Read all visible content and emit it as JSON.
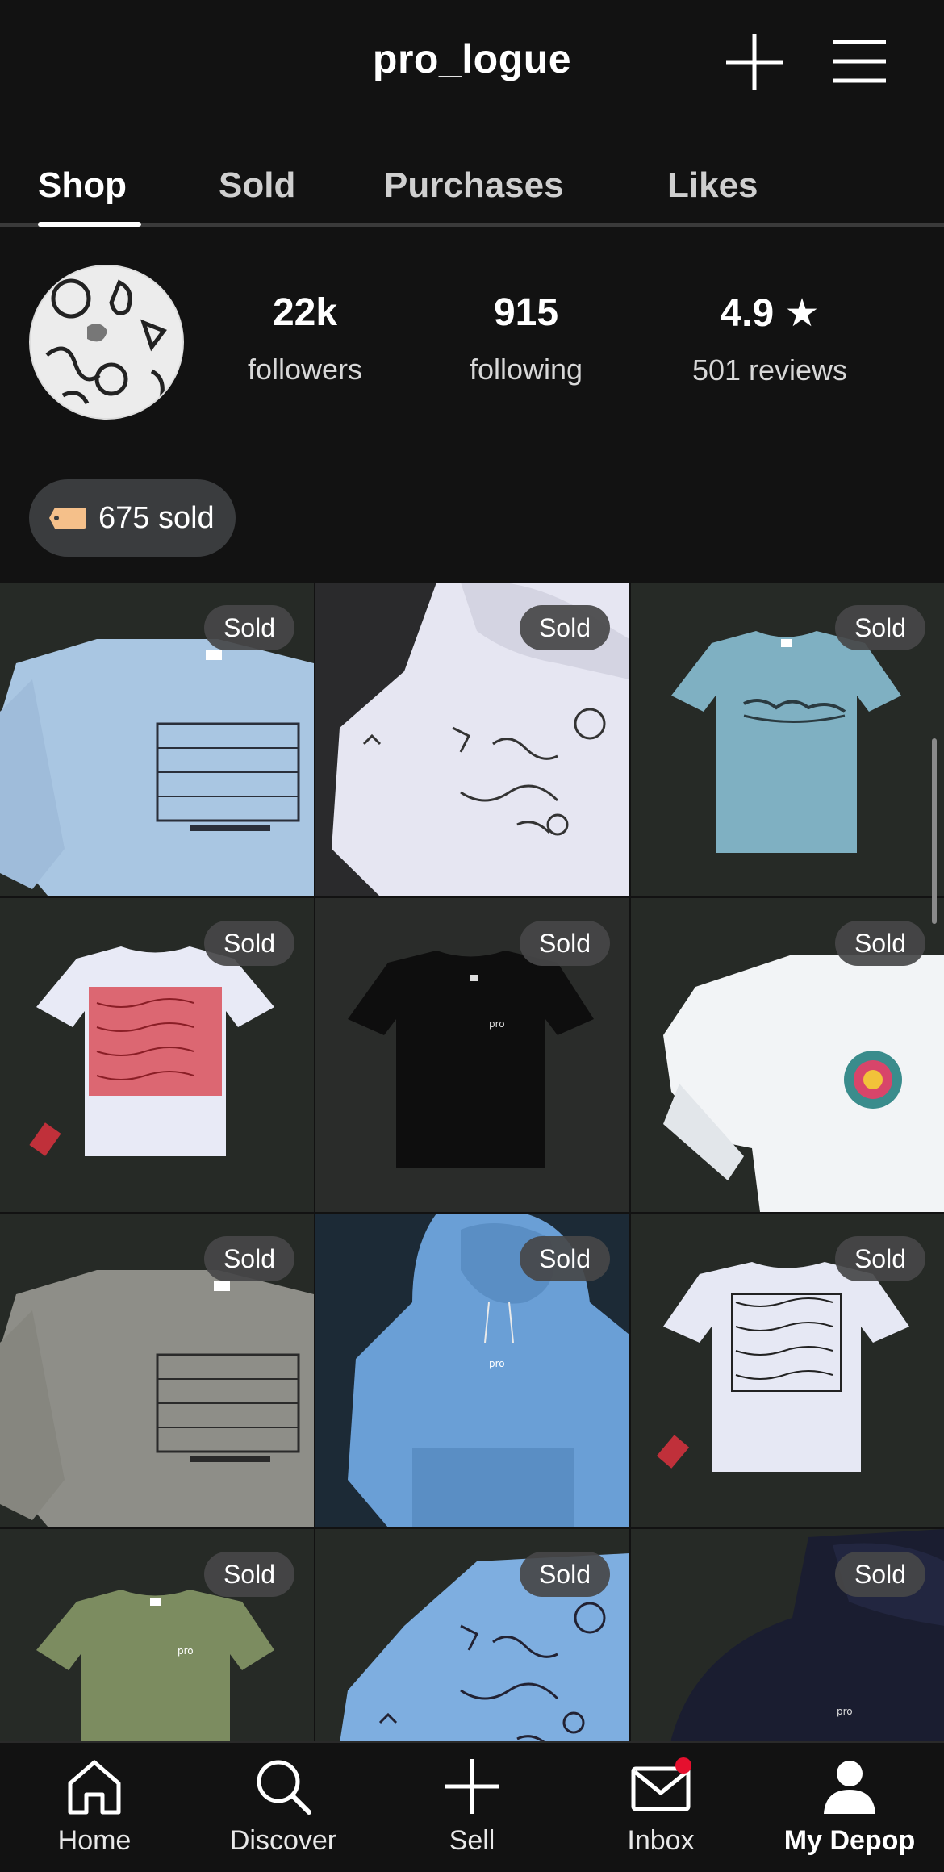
{
  "header": {
    "username": "pro_logue",
    "icons": {
      "add": "plus-icon",
      "menu": "hamburger-menu-icon"
    }
  },
  "tabs": [
    {
      "label": "Shop",
      "active": true
    },
    {
      "label": "Sold",
      "active": false
    },
    {
      "label": "Purchases",
      "active": false
    },
    {
      "label": "Likes",
      "active": false
    }
  ],
  "profile": {
    "stats": [
      {
        "value": "22k",
        "label": "followers"
      },
      {
        "value": "915",
        "label": "following"
      },
      {
        "value": "4.9 ★",
        "label": "501 reviews"
      }
    ],
    "sold_count": "675 sold"
  },
  "grid": {
    "badge_label": "Sold",
    "items": [
      {
        "product": "light blue long sleeve tee",
        "badge": "Sold"
      },
      {
        "product": "white hoodie",
        "badge": "Sold"
      },
      {
        "product": "teal tee",
        "badge": "Sold"
      },
      {
        "product": "white tee red print",
        "badge": "Sold"
      },
      {
        "product": "black tee",
        "badge": "Sold"
      },
      {
        "product": "white long sleeve tee",
        "badge": "Sold"
      },
      {
        "product": "grey long sleeve tee",
        "badge": "Sold"
      },
      {
        "product": "blue hoodie",
        "badge": "Sold"
      },
      {
        "product": "white tee black print",
        "badge": "Sold"
      },
      {
        "product": "olive tee",
        "badge": "Sold"
      },
      {
        "product": "blue sweatshirt",
        "badge": "Sold"
      },
      {
        "product": "navy hoodie",
        "badge": "Sold"
      }
    ]
  },
  "bottom_nav": [
    {
      "label": "Home",
      "icon": "home-icon",
      "active": false
    },
    {
      "label": "Discover",
      "icon": "search-icon",
      "active": false
    },
    {
      "label": "Sell",
      "icon": "plus-icon",
      "active": false
    },
    {
      "label": "Inbox",
      "icon": "mail-icon",
      "active": false,
      "notification": true
    },
    {
      "label": "My Depop",
      "icon": "profile-icon",
      "active": true
    }
  ],
  "colors": {
    "background": "#121212",
    "pill": "#3a3c3e",
    "badge": "#464648",
    "notification": "#e5102e"
  }
}
